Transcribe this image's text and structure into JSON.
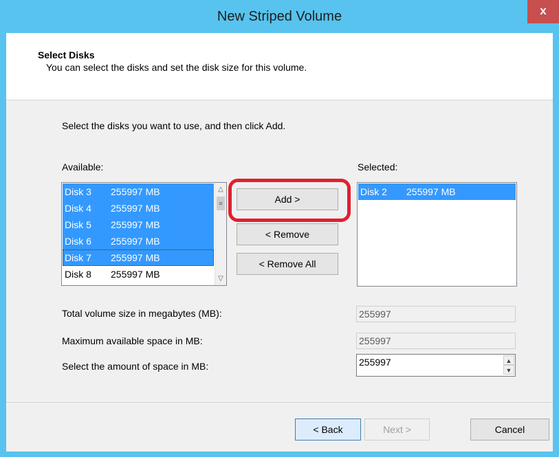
{
  "window": {
    "title": "New Striped Volume",
    "close_label": "x"
  },
  "header": {
    "title": "Select Disks",
    "subtitle": "You can select the disks and set the disk size for this volume."
  },
  "instruction": "Select the disks you want to use, and then click Add.",
  "available": {
    "label": "Available:",
    "items": [
      {
        "disk": "Disk 3",
        "size": "255997 MB",
        "selected": true
      },
      {
        "disk": "Disk 4",
        "size": "255997 MB",
        "selected": true
      },
      {
        "disk": "Disk 5",
        "size": "255997 MB",
        "selected": true
      },
      {
        "disk": "Disk 6",
        "size": "255997 MB",
        "selected": true
      },
      {
        "disk": "Disk 7",
        "size": "255997 MB",
        "selected": true,
        "focused": true
      },
      {
        "disk": "Disk 8",
        "size": "255997 MB",
        "selected": false
      }
    ]
  },
  "selected": {
    "label": "Selected:",
    "items": [
      {
        "disk": "Disk 2",
        "size": "255997 MB",
        "selected": true
      }
    ]
  },
  "buttons": {
    "add": "Add >",
    "remove": "< Remove",
    "remove_all": "< Remove All",
    "back": "< Back",
    "next": "Next >",
    "cancel": "Cancel"
  },
  "sizes": {
    "total_label": "Total volume size in megabytes (MB):",
    "total_value": "255997",
    "max_label": "Maximum available space in MB:",
    "max_value": "255997",
    "amount_label": "Select the amount of space in MB:",
    "amount_value": "255997"
  },
  "colors": {
    "titlebar": "#57c3ee",
    "selection": "#3399ff",
    "highlight": "#e02030",
    "close": "#c74f4f"
  }
}
